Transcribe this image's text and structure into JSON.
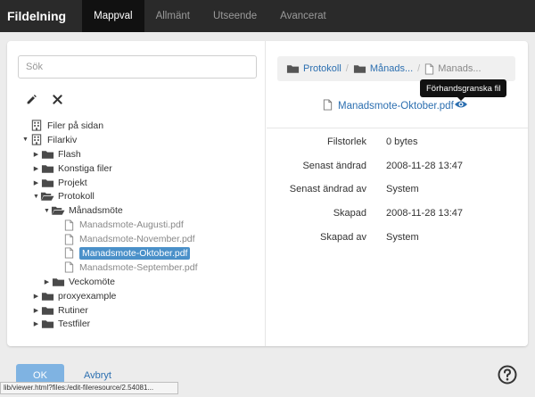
{
  "topbar": {
    "brand": "Fildelning",
    "tabs": [
      {
        "label": "Mappval",
        "active": true
      },
      {
        "label": "Allmänt",
        "active": false
      },
      {
        "label": "Utseende",
        "active": false
      },
      {
        "label": "Avancerat",
        "active": false
      }
    ]
  },
  "search": {
    "placeholder": "Sök",
    "value": ""
  },
  "toolbar": {
    "edit_icon": "pencil-icon",
    "delete_icon": "close-icon"
  },
  "tree": [
    {
      "label": "Filer på sidan",
      "icon": "building-icon",
      "caret": "none",
      "level": 0,
      "type": "root"
    },
    {
      "label": "Filarkiv",
      "icon": "building-icon",
      "caret": "down",
      "level": 0,
      "type": "root"
    },
    {
      "label": "Flash",
      "icon": "folder-icon",
      "caret": "right",
      "level": 1,
      "type": "folder"
    },
    {
      "label": "Konstiga filer",
      "icon": "folder-icon",
      "caret": "right",
      "level": 1,
      "type": "folder"
    },
    {
      "label": "Projekt",
      "icon": "folder-icon",
      "caret": "right",
      "level": 1,
      "type": "folder"
    },
    {
      "label": "Protokoll",
      "icon": "folder-open-icon",
      "caret": "down",
      "level": 1,
      "type": "folder"
    },
    {
      "label": "Månadsmöte",
      "icon": "folder-open-icon",
      "caret": "down",
      "level": 2,
      "type": "folder"
    },
    {
      "label": "Manadsmote-Augusti.pdf",
      "icon": "file-icon",
      "caret": "none",
      "level": 3,
      "type": "file"
    },
    {
      "label": "Manadsmote-November.pdf",
      "icon": "file-icon",
      "caret": "none",
      "level": 3,
      "type": "file"
    },
    {
      "label": "Manadsmote-Oktober.pdf",
      "icon": "file-icon",
      "caret": "none",
      "level": 3,
      "type": "file",
      "selected": true
    },
    {
      "label": "Manadsmote-September.pdf",
      "icon": "file-icon",
      "caret": "none",
      "level": 3,
      "type": "file"
    },
    {
      "label": "Veckomöte",
      "icon": "folder-icon",
      "caret": "right",
      "level": 2,
      "type": "folder"
    },
    {
      "label": "proxyexample",
      "icon": "folder-icon",
      "caret": "right",
      "level": 1,
      "type": "folder"
    },
    {
      "label": "Rutiner",
      "icon": "folder-icon",
      "caret": "right",
      "level": 1,
      "type": "folder"
    },
    {
      "label": "Testfiler",
      "icon": "folder-icon",
      "caret": "right",
      "level": 1,
      "type": "folder"
    }
  ],
  "breadcrumb": {
    "items": [
      {
        "label": "Protokoll",
        "icon": "folder-icon",
        "kind": "link"
      },
      {
        "label": "Månads...",
        "icon": "folder-icon",
        "kind": "link"
      },
      {
        "label": "Manads...",
        "icon": "file-icon",
        "kind": "current"
      }
    ],
    "separator": "/"
  },
  "preview": {
    "tooltip": "Förhandsgranska fil",
    "filename": "Manadsmote-Oktober.pdf",
    "file_icon": "file-icon",
    "preview_icon": "eye-icon"
  },
  "properties": [
    {
      "key": "Filstorlek",
      "value": "0 bytes"
    },
    {
      "key": "Senast ändrad",
      "value": "2008-11-28 13:47"
    },
    {
      "key": "Senast ändrad av",
      "value": "System"
    },
    {
      "key": "Skapad",
      "value": "2008-11-28 13:47"
    },
    {
      "key": "Skapad av",
      "value": "System"
    }
  ],
  "footer": {
    "ok_label": "OK",
    "cancel_label": "Avbryt",
    "help_icon": "help-icon"
  },
  "statusbar": {
    "text": "lib/viewer.html?files:/edit-fileresource/2.54081..."
  },
  "colors": {
    "topbar": "#2a2a2a",
    "active_tab": "#111111",
    "link": "#2c6fb0",
    "selection": "#4a90c9",
    "ok_button": "#7fb3e2"
  }
}
